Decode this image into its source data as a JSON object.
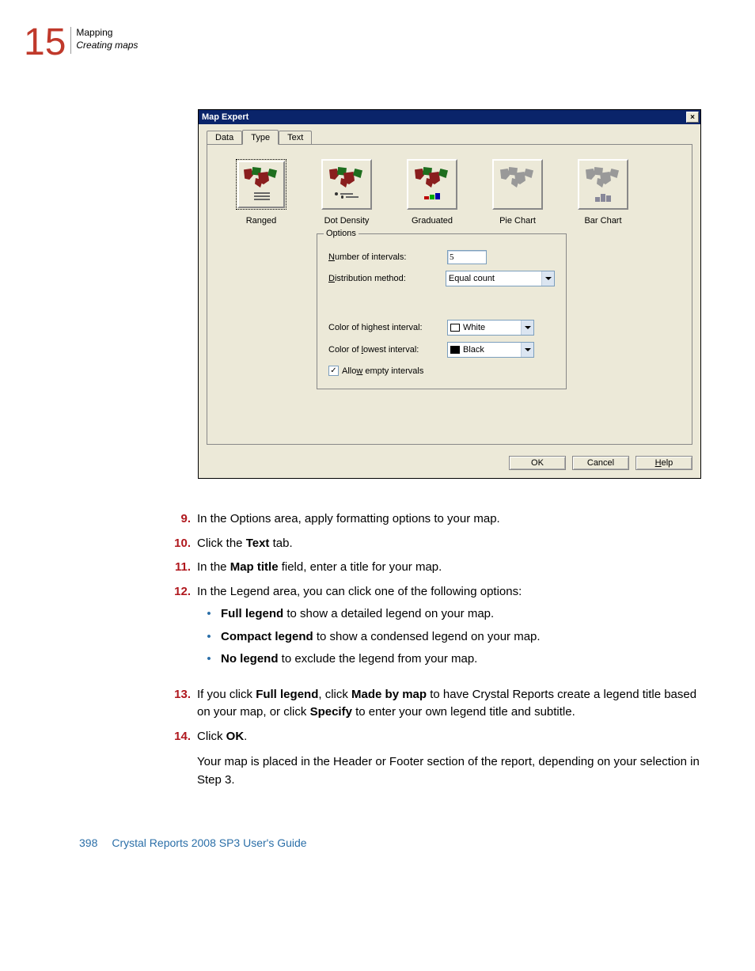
{
  "header": {
    "chapter_number": "15",
    "line1": "Mapping",
    "line2": "Creating maps"
  },
  "dialog": {
    "title": "Map Expert",
    "tabs": {
      "data": "Data",
      "type": "Type",
      "text": "Text"
    },
    "types": {
      "ranged": "Ranged",
      "dot_density": "Dot Density",
      "graduated": "Graduated",
      "pie_chart": "Pie Chart",
      "bar_chart": "Bar Chart"
    },
    "options": {
      "legend": "Options",
      "num_intervals_label_pre": "N",
      "num_intervals_label_post": "umber of intervals:",
      "num_intervals_value": "5",
      "dist_method_label_pre": "D",
      "dist_method_label_post": "istribution method:",
      "dist_method_value": "Equal count",
      "highest_label": "Color of highest interval:",
      "highest_value": "White",
      "lowest_label_pre": "Color of ",
      "lowest_label_u": "l",
      "lowest_label_post": "owest interval:",
      "lowest_value": "Black",
      "allow_empty_pre": "Allo",
      "allow_empty_u": "w",
      "allow_empty_post": " empty intervals"
    },
    "buttons": {
      "ok": "OK",
      "cancel": "Cancel",
      "help_u": "H",
      "help_post": "elp"
    }
  },
  "steps": {
    "s9": {
      "num": "9.",
      "text": "In the Options area, apply formatting options to your map."
    },
    "s10": {
      "num": "10.",
      "pre": "Click the ",
      "bold": "Text",
      "post": " tab."
    },
    "s11": {
      "num": "11.",
      "pre": "In the ",
      "bold": "Map title",
      "post": " field, enter a title for your map."
    },
    "s12": {
      "num": "12.",
      "text": "In the Legend area, you can click one of the following options:",
      "b1_b": "Full legend",
      "b1_t": " to show a detailed legend on your map.",
      "b2_b": "Compact legend",
      "b2_t": " to show a condensed legend on your map.",
      "b3_b": "No legend",
      "b3_t": " to exclude the legend from your map."
    },
    "s13": {
      "num": "13.",
      "p1": "If you click ",
      "b1": "Full legend",
      "p2": ", click ",
      "b2": "Made by map",
      "p3": " to have Crystal Reports create a legend title based on your map, or click ",
      "b3": "Specify",
      "p4": " to enter your own legend title and subtitle."
    },
    "s14": {
      "num": "14.",
      "pre": "Click ",
      "bold": "OK",
      "post": ".",
      "para": "Your map is placed in the Header or Footer section of the report, depending on your selection in Step 3."
    }
  },
  "footer": {
    "page": "398",
    "title": "Crystal Reports 2008 SP3 User's Guide"
  }
}
